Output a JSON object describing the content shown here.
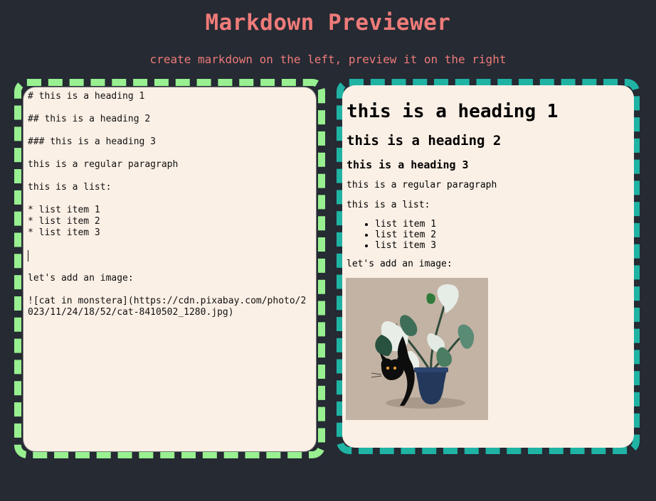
{
  "header": {
    "title": "Markdown Previewer",
    "subtitle": "create markdown on the left, preview it on the right"
  },
  "editor": {
    "lines_before_caret": "# this is a heading 1\n\n## this is a heading 2\n\n### this is a heading 3\n\nthis is a regular paragraph\n\nthis is a list:\n\n* list item 1\n* list item 2\n* list item 3\n\n",
    "lines_after_caret": "\n\nlet's add an image:\n\n![cat in monstera](https://cdn.pixabay.com/photo/2023/11/24/18/52/cat-8410502_1280.jpg)"
  },
  "preview": {
    "h1": "this is a heading 1",
    "h2": "this is a heading 2",
    "h3": "this is a heading 3",
    "paragraph": "this is a regular paragraph",
    "list_intro": "this is a list:",
    "list_items": [
      "list item 1",
      "list item 2",
      "list item 3"
    ],
    "image_intro": "let's add an image:",
    "image_alt": "cat in monstera"
  },
  "colors": {
    "background": "#252a33",
    "title": "#ee7b79",
    "editor_frame": "#98f090",
    "preview_frame": "#1fb3a4",
    "panel": "#fbf0e6"
  }
}
